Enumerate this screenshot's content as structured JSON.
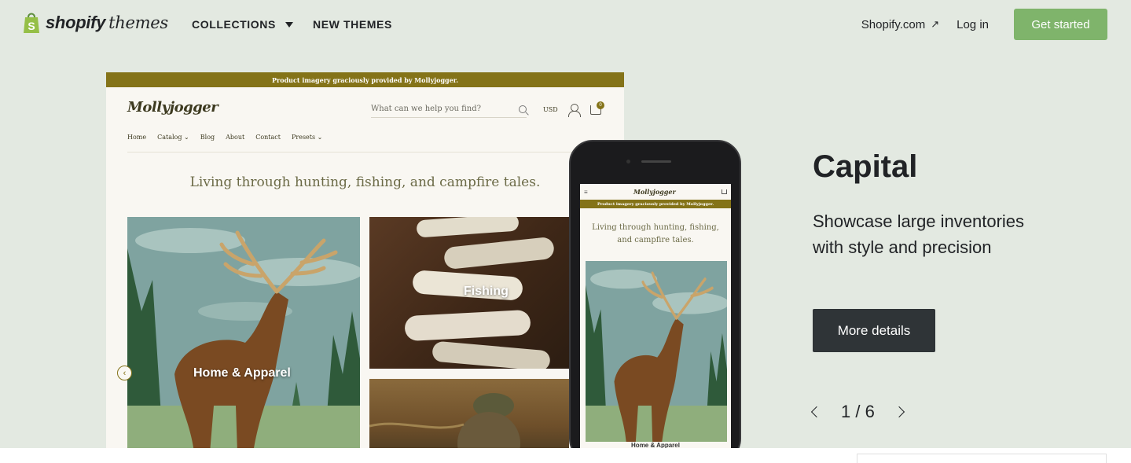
{
  "nav": {
    "brand_bold": "shopify",
    "brand_light": "themes",
    "collections_label": "COLLECTIONS",
    "new_themes_label": "NEW THEMES",
    "shopify_com_label": "Shopify.com",
    "login_label": "Log in",
    "get_started_label": "Get started"
  },
  "preview": {
    "banner": "Product imagery graciously provided by Mollyjogger.",
    "logo": "Mollyjogger",
    "search_placeholder": "What can we help you find?",
    "currency": "USD",
    "cart_count": "0",
    "menu": [
      "Home",
      "Catalog ⌄",
      "Blog",
      "About",
      "Contact",
      "Presets ⌄"
    ],
    "tagline": "Living through hunting, fishing, and campfire tales.",
    "tile_home_apparel": "Home & Apparel",
    "tile_fishing": "Fishing"
  },
  "phone": {
    "menu_glyph": "≡",
    "logo": "Mollyjogger",
    "banner": "Product imagery graciously provided by Mollyjogger.",
    "tagline": "Living through hunting, fishing, and campfire tales.",
    "tile_label": "Home & Apparel"
  },
  "theme": {
    "name": "Capital",
    "description": "Showcase large inventories with style and precision",
    "details_label": "More details",
    "pager": "1 / 6"
  },
  "colors": {
    "page_bg": "#e3e9e1",
    "accent_green": "#7fb46b",
    "banner_olive": "#847318",
    "button_dark": "#2f3437"
  }
}
